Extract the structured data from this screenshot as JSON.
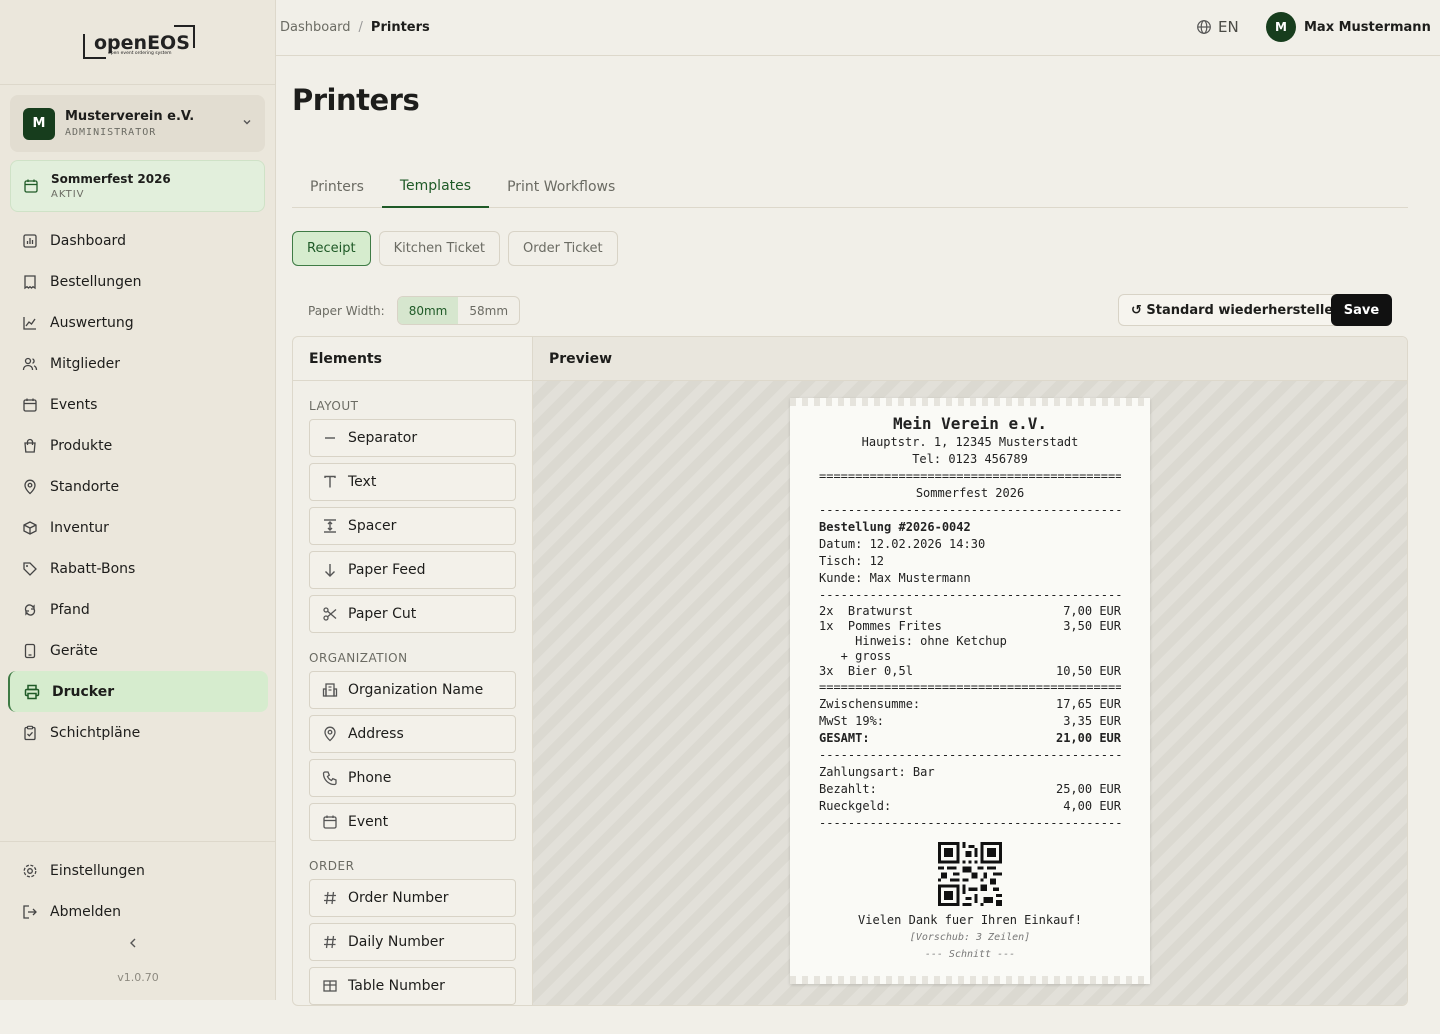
{
  "sidebar": {
    "logo_text": "openEOS",
    "logo_tagline": "open event ordering system",
    "org": {
      "initial": "M",
      "name": "Musterverein e.V.",
      "role": "ADMINISTRATOR"
    },
    "event": {
      "name": "Sommerfest 2026",
      "status": "AKTIV"
    },
    "items": [
      {
        "label": "Dashboard",
        "icon": "chart-icon"
      },
      {
        "label": "Bestellungen",
        "icon": "receipt-icon"
      },
      {
        "label": "Auswertung",
        "icon": "trend-icon"
      },
      {
        "label": "Mitglieder",
        "icon": "users-icon"
      },
      {
        "label": "Events",
        "icon": "calendar-icon"
      },
      {
        "label": "Produkte",
        "icon": "bag-icon"
      },
      {
        "label": "Standorte",
        "icon": "pin-icon"
      },
      {
        "label": "Inventur",
        "icon": "box-icon"
      },
      {
        "label": "Rabatt-Bons",
        "icon": "tag-icon"
      },
      {
        "label": "Pfand",
        "icon": "recycle-icon"
      },
      {
        "label": "Geräte",
        "icon": "device-icon"
      },
      {
        "label": "Drucker",
        "icon": "printer-icon"
      },
      {
        "label": "Schichtpläne",
        "icon": "clipboard-icon"
      }
    ],
    "active_item": "Drucker",
    "settings": "Einstellungen",
    "logout": "Abmelden",
    "version": "v1.0.70"
  },
  "topbar": {
    "breadcrumb_root": "Dashboard",
    "breadcrumb_sep": "/",
    "breadcrumb_current": "Printers",
    "lang": "EN",
    "user_initial": "M",
    "user_name": "Max Mustermann"
  },
  "page": {
    "title": "Printers",
    "tabs": [
      "Printers",
      "Templates",
      "Print Workflows"
    ],
    "active_tab": "Templates",
    "subtabs": [
      "Receipt",
      "Kitchen Ticket",
      "Order Ticket"
    ],
    "active_subtab": "Receipt",
    "paper_width_label": "Paper Width:",
    "paper_widths": [
      "80mm",
      "58mm"
    ],
    "active_width": "80mm",
    "restore_label": "↺ Standard wiederherstellen",
    "save_label": "Save"
  },
  "elements": {
    "title": "Elements",
    "groups": [
      {
        "name": "LAYOUT",
        "items": [
          "Separator",
          "Text",
          "Spacer",
          "Paper Feed",
          "Paper Cut"
        ]
      },
      {
        "name": "ORGANIZATION",
        "items": [
          "Organization Name",
          "Address",
          "Phone",
          "Event"
        ]
      },
      {
        "name": "ORDER",
        "items": [
          "Order Number",
          "Daily Number",
          "Table Number"
        ]
      }
    ]
  },
  "preview": {
    "title": "Preview",
    "receipt": {
      "org_name": "Mein Verein e.V.",
      "address": "Hauptstr. 1, 12345 Musterstadt",
      "phone": "Tel: 0123 456789",
      "sep_double": "===========================================",
      "sep_single": "-------------------------------------------",
      "event": "Sommerfest 2026",
      "order": "Bestellung #2026-0042",
      "date": "Datum: 12.02.2026 14:30",
      "table": "Tisch: 12",
      "customer": "Kunde: Max Mustermann",
      "items": [
        {
          "left": "2x  Bratwurst",
          "right": "7,00 EUR"
        },
        {
          "left": "1x  Pommes Frites",
          "right": "3,50 EUR"
        }
      ],
      "note": "     Hinweis: ohne Ketchup",
      "modifier": "   + gross",
      "item3": {
        "left": "3x  Bier 0,5l",
        "right": "10,50 EUR"
      },
      "subtotal": {
        "left": "Zwischensumme:",
        "right": "17,65 EUR"
      },
      "tax": {
        "left": "MwSt 19%:",
        "right": "3,35 EUR"
      },
      "total": {
        "left": "GESAMT:",
        "right": "21,00 EUR"
      },
      "payment": "Zahlungsart: Bar",
      "paid": {
        "left": "Bezahlt:",
        "right": "25,00 EUR"
      },
      "change": {
        "left": "Rueckgeld:",
        "right": "4,00 EUR"
      },
      "thanks": "Vielen Dank fuer Ihren Einkauf!",
      "feed": "[Vorschub: 3 Zeilen]",
      "cut": "--- Schnitt ---"
    }
  },
  "colors": {
    "accent": "#1f5a27",
    "active_bg": "#d6ecce",
    "sidebar_bg": "#ebe7dc"
  }
}
